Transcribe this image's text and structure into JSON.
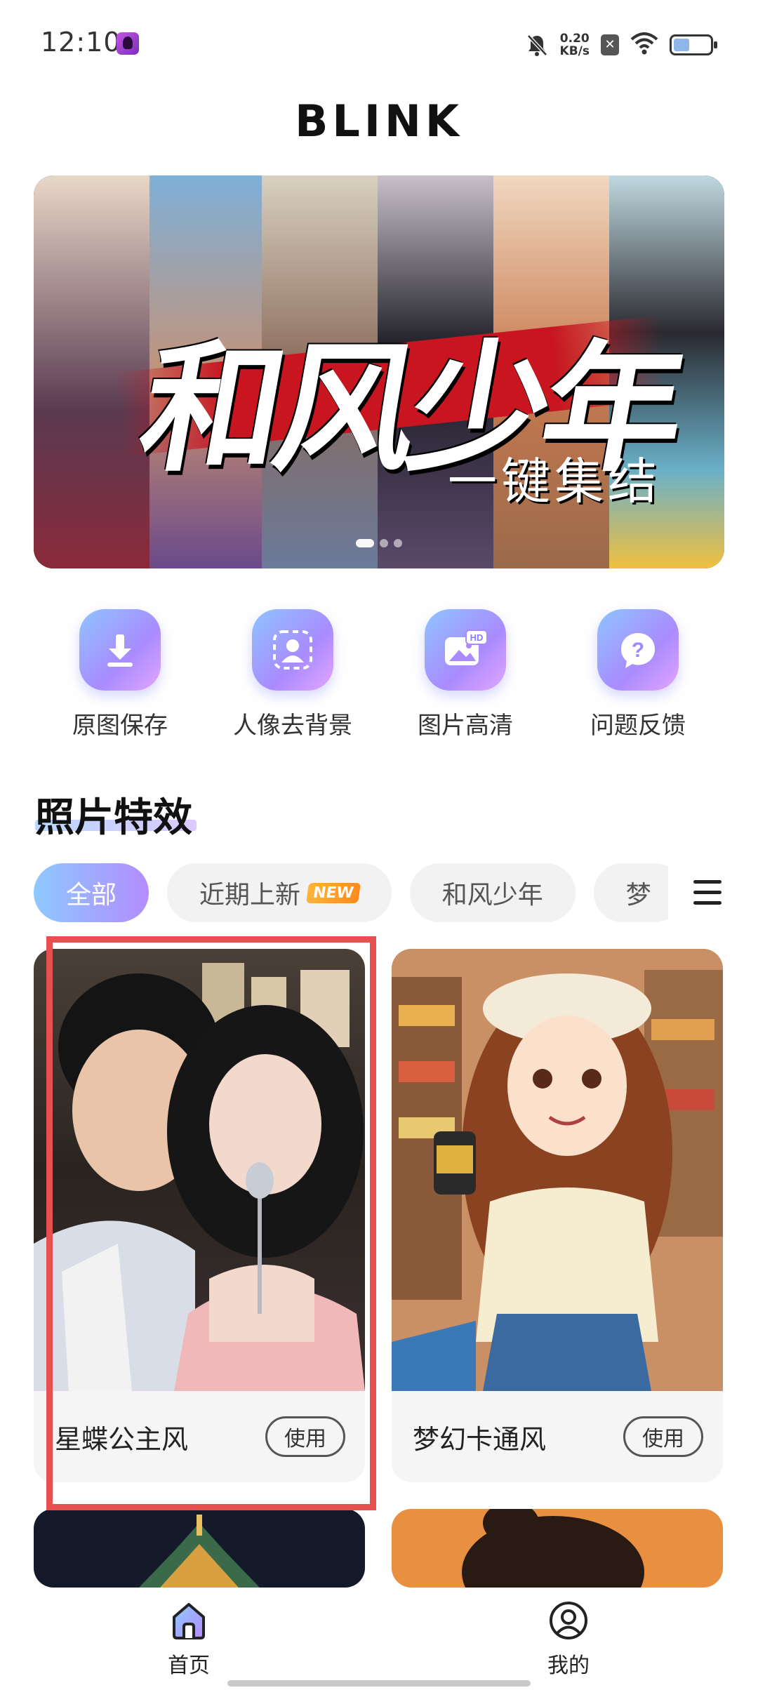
{
  "status_bar": {
    "time": "12:10",
    "net_speed_value": "0.20",
    "net_speed_unit": "KB/s",
    "battery_level": 0.44
  },
  "header": {
    "title": "BLINK"
  },
  "banner": {
    "title": "和风少年",
    "subtitle": "一键集结",
    "slide_count": 3,
    "active_slide": 1
  },
  "quick_actions": [
    {
      "label": "原图保存",
      "icon": "download-icon"
    },
    {
      "label": "人像去背景",
      "icon": "portrait-icon"
    },
    {
      "label": "图片高清",
      "icon": "hd-image-icon"
    },
    {
      "label": "问题反馈",
      "icon": "question-icon"
    }
  ],
  "section": {
    "title": "照片特效"
  },
  "filters": {
    "tabs": [
      {
        "label": "全部",
        "active": true
      },
      {
        "label": "近期上新",
        "badge": "NEW"
      },
      {
        "label": "和风少年"
      },
      {
        "label": "梦"
      }
    ]
  },
  "cards": [
    {
      "title": "星蝶公主风",
      "button": "使用"
    },
    {
      "title": "梦幻卡通风",
      "button": "使用"
    }
  ],
  "bottom_nav": {
    "home": "首页",
    "mine": "我的"
  },
  "colors": {
    "accent_start": "#8ec9ff",
    "accent_end": "#b38cff",
    "highlight": "#e8504f"
  }
}
